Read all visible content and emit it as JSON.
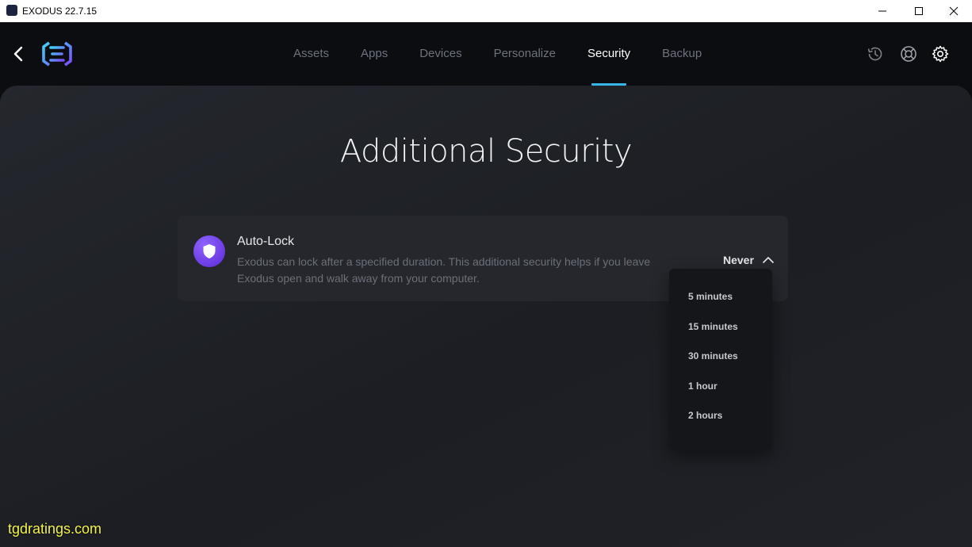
{
  "window": {
    "title": "EXODUS 22.7.15"
  },
  "nav": {
    "tabs": [
      {
        "label": "Assets"
      },
      {
        "label": "Apps"
      },
      {
        "label": "Devices"
      },
      {
        "label": "Personalize"
      },
      {
        "label": "Security",
        "active": true
      },
      {
        "label": "Backup"
      }
    ],
    "icons": [
      "back-icon",
      "exodus-logo",
      "history-icon",
      "support-icon",
      "gear-icon"
    ]
  },
  "page": {
    "title": "Additional Security"
  },
  "auto_lock": {
    "title": "Auto-Lock",
    "description": "Exodus can lock after a specified duration. This additional security helps if you leave Exodus open and walk away from your computer.",
    "selected": "Never",
    "options": [
      "5 minutes",
      "15 minutes",
      "30 minutes",
      "1 hour",
      "2 hours"
    ]
  },
  "watermark": "tgdratings.com",
  "colors": {
    "accent": "#38b6e8",
    "shield": "#6a3cf0",
    "background": "#0c0d10"
  }
}
